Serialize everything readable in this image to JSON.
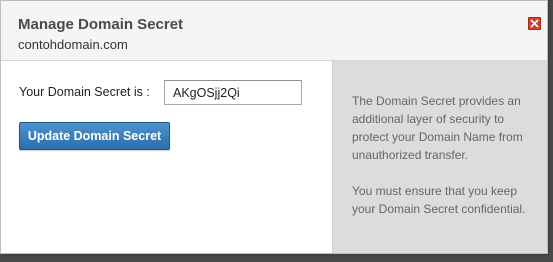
{
  "dialog": {
    "title": "Manage Domain Secret",
    "domain": "contohdomain.com",
    "close_icon": "close-x-icon"
  },
  "form": {
    "label": "Your Domain Secret is :",
    "secret_value": "AKgOSjj2Qi",
    "update_button": "Update Domain Secret"
  },
  "info": {
    "paragraph_1": "The Domain Secret provides an additional layer of security to protect your Domain Name from unauthorized transfer.",
    "paragraph_2": "You must ensure that you keep your Domain Secret confidential."
  },
  "colors": {
    "accent_button": "#2a6eac",
    "close_button": "#d8402e",
    "side_panel": "#dcdcdc"
  }
}
